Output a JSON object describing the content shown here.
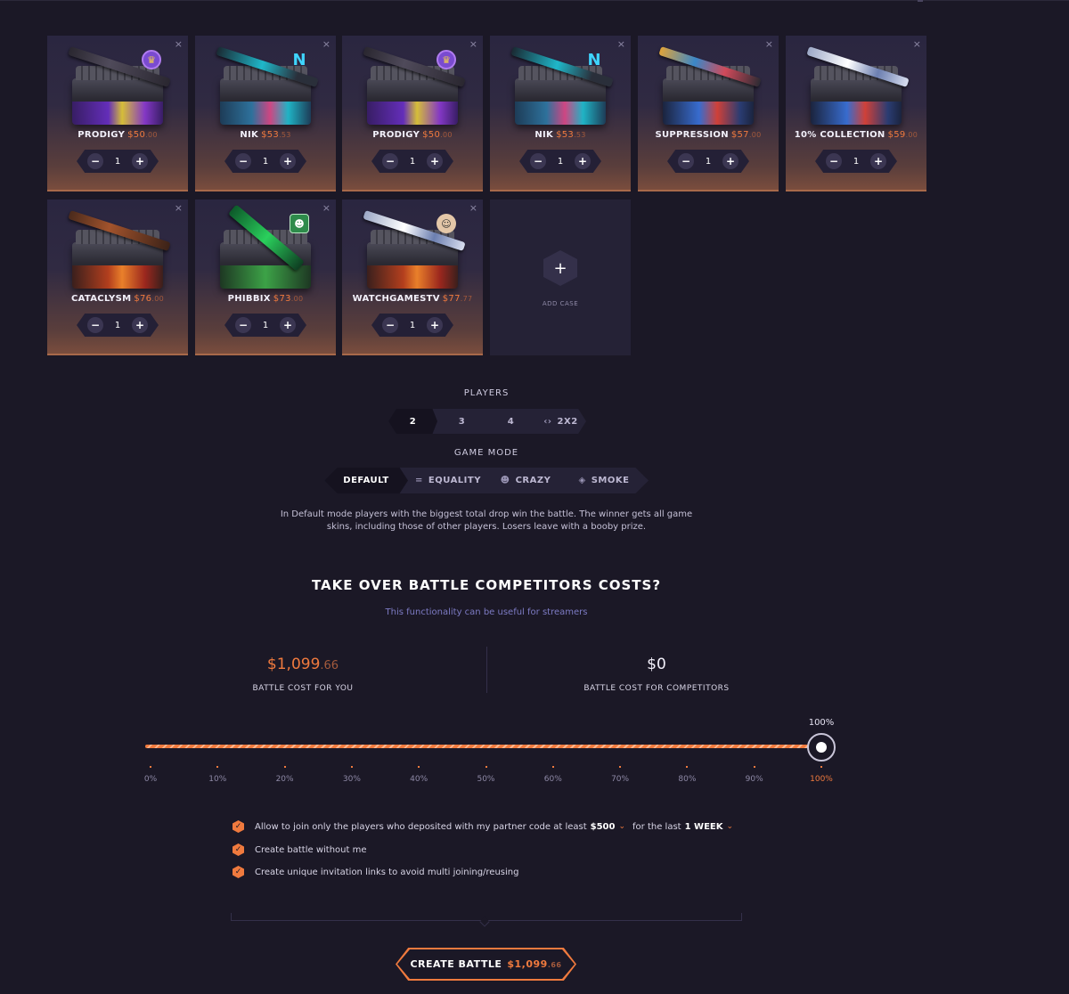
{
  "cases": [
    {
      "name": "PRODIGY",
      "price": "$50",
      "cents": ".00",
      "qty": "1",
      "badge": "crown",
      "gun": "dark",
      "decal": "purple"
    },
    {
      "name": "NIK",
      "price": "$53",
      "cents": ".53",
      "qty": "1",
      "badge": "n",
      "gun": "cyan",
      "decal": "cyan"
    },
    {
      "name": "PRODIGY",
      "price": "$50",
      "cents": ".00",
      "qty": "1",
      "badge": "crown",
      "gun": "dark",
      "decal": "purple"
    },
    {
      "name": "NIK",
      "price": "$53",
      "cents": ".53",
      "qty": "1",
      "badge": "n",
      "gun": "cyan",
      "decal": "cyan"
    },
    {
      "name": "SUPPRESSION",
      "price": "$57",
      "cents": ".00",
      "qty": "1",
      "badge": "",
      "gun": "colorful",
      "decal": "blue"
    },
    {
      "name": "10% COLLECTION",
      "price": "$59",
      "cents": ".00",
      "qty": "1",
      "badge": "",
      "gun": "white",
      "decal": "blue"
    },
    {
      "name": "CATACLYSM",
      "price": "$76",
      "cents": ".00",
      "qty": "1",
      "badge": "",
      "gun": "rust",
      "decal": "orange"
    },
    {
      "name": "PHIBBIX",
      "price": "$73",
      "cents": ".00",
      "qty": "1",
      "badge": "shield",
      "gun": "knife",
      "decal": "green"
    },
    {
      "name": "WATCHGAMESTV",
      "price": "$77",
      "cents": ".77",
      "qty": "1",
      "badge": "face",
      "gun": "white",
      "decal": "orange"
    }
  ],
  "add_case_label": "ADD CASE",
  "players": {
    "label": "PLAYERS",
    "options": [
      "2",
      "3",
      "4",
      "2X2"
    ],
    "selected": "2"
  },
  "game_mode": {
    "label": "GAME MODE",
    "options": [
      "DEFAULT",
      "EQUALITY",
      "CRAZY",
      "SMOKE"
    ],
    "selected": "DEFAULT",
    "description": "In Default mode players with the biggest total drop win the battle. The winner gets all game skins, including those of other players. Losers leave with a booby prize."
  },
  "take_over": {
    "title": "TAKE OVER BATTLE COMPETITORS COSTS?",
    "subtitle": "This functionality can be useful for streamers",
    "cost_you_main": "$1,099",
    "cost_you_cents": ".66",
    "cost_you_label": "BATTLE COST FOR YOU",
    "cost_comp": "$0",
    "cost_comp_label": "BATTLE COST FOR COMPETITORS"
  },
  "slider": {
    "value_label": "100%",
    "value": 100,
    "ticks": [
      "0%",
      "10%",
      "20%",
      "30%",
      "40%",
      "50%",
      "60%",
      "70%",
      "80%",
      "90%",
      "100%"
    ]
  },
  "options": {
    "opt1_text_a": "Allow to join only the players who deposited with my partner code at least",
    "opt1_amount": "$500",
    "opt1_text_b": "for the last",
    "opt1_period": "1 WEEK",
    "opt2_text": "Create battle without me",
    "opt3_text": "Create unique invitation links to avoid multi joining/reusing"
  },
  "create_button": {
    "label": "CREATE BATTLE",
    "price": "$1,099",
    "cents": ".66"
  },
  "colors": {
    "background": "#1b1826",
    "accent": "#f07a3e",
    "card": "#2a2640"
  }
}
